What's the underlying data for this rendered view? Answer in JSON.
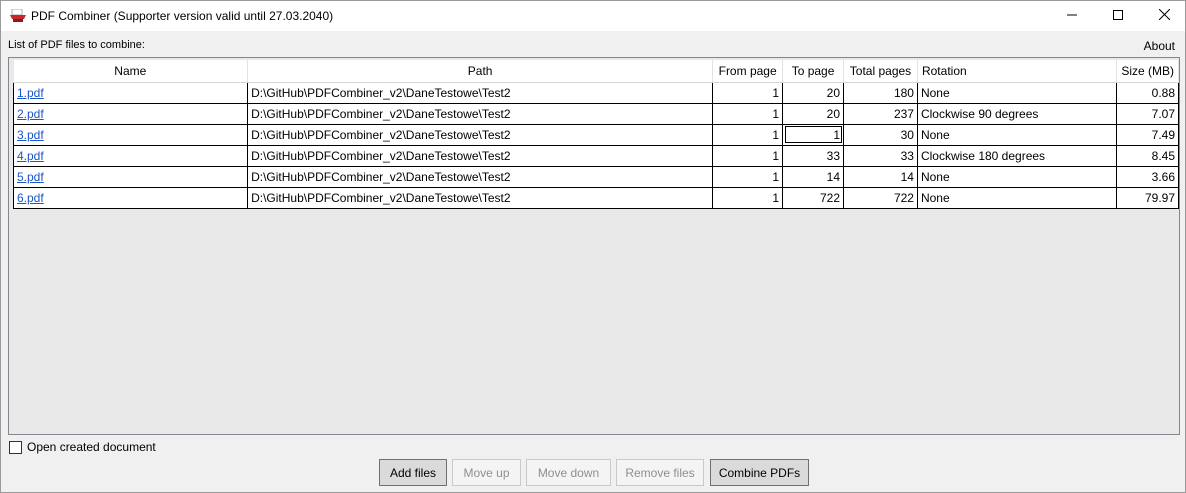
{
  "window": {
    "title": "PDF Combiner (Supporter version valid until 27.03.2040)",
    "minimize_icon": "minimize-icon",
    "maximize_icon": "maximize-icon",
    "close_icon": "close-icon"
  },
  "header": {
    "list_label": "List of PDF files to combine:",
    "about_label": "About"
  },
  "table": {
    "columns": [
      "Name",
      "Path",
      "From page",
      "To page",
      "Total pages",
      "Rotation",
      "Size (MB)"
    ],
    "rows": [
      {
        "name": "1.pdf",
        "path": "D:\\GitHub\\PDFCombiner_v2\\DaneTestowe\\Test2",
        "from_page": "1",
        "to_page": "20",
        "total_pages": "180",
        "rotation": "None",
        "size": "0.88"
      },
      {
        "name": "2.pdf",
        "path": "D:\\GitHub\\PDFCombiner_v2\\DaneTestowe\\Test2",
        "from_page": "1",
        "to_page": "20",
        "total_pages": "237",
        "rotation": "Clockwise 90 degrees",
        "size": "7.07"
      },
      {
        "name": "3.pdf",
        "path": "D:\\GitHub\\PDFCombiner_v2\\DaneTestowe\\Test2",
        "from_page": "1",
        "to_page": "1",
        "total_pages": "30",
        "rotation": "None",
        "size": "7.49"
      },
      {
        "name": "4.pdf",
        "path": "D:\\GitHub\\PDFCombiner_v2\\DaneTestowe\\Test2",
        "from_page": "1",
        "to_page": "33",
        "total_pages": "33",
        "rotation": "Clockwise 180 degrees",
        "size": "8.45"
      },
      {
        "name": "5.pdf",
        "path": "D:\\GitHub\\PDFCombiner_v2\\DaneTestowe\\Test2",
        "from_page": "1",
        "to_page": "14",
        "total_pages": "14",
        "rotation": "None",
        "size": "3.66"
      },
      {
        "name": "6.pdf",
        "path": "D:\\GitHub\\PDFCombiner_v2\\DaneTestowe\\Test2",
        "from_page": "1",
        "to_page": "722",
        "total_pages": "722",
        "rotation": "None",
        "size": "79.97"
      }
    ]
  },
  "footer": {
    "open_created_label": "Open created document",
    "open_created_checked": false,
    "buttons": {
      "add_files": "Add files",
      "move_up": "Move up",
      "move_down": "Move down",
      "remove_files": "Remove files",
      "combine": "Combine PDFs"
    }
  },
  "colors": {
    "link": "#1a56c8",
    "app_icon_red": "#c8262c"
  }
}
